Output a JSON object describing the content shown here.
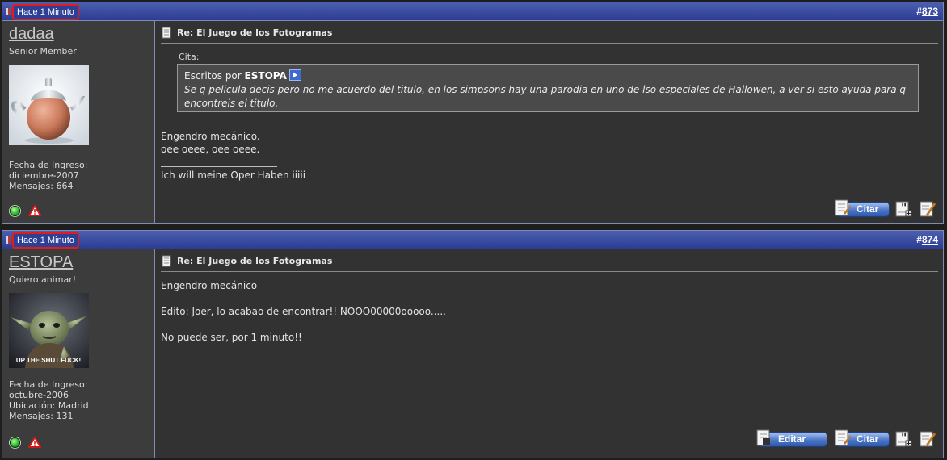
{
  "posts": [
    {
      "time": "Hace 1 Minuto",
      "hash": "#",
      "number": "873",
      "username": "dadaa",
      "usertitle": "Senior Member",
      "join_label": "Fecha de Ingreso:",
      "join_date": "diciembre-2007",
      "messages": "Mensajes: 664",
      "title": "Re: El Juego de los Fotogramas",
      "quote": {
        "label": "Cita:",
        "by_prefix": "Escritos por",
        "by_user": "ESTOPA",
        "text": "Se q pelicula decis pero no me acuerdo del titulo, en los simpsons hay una parodia en uno de lso especiales de Hallowen, a ver si esto ayuda para q encontreis el titulo."
      },
      "body": [
        "Engendro mecánico.",
        "oee oeee, oee oeee."
      ],
      "signature": "Ich will meine Oper Haben iiiii",
      "buttons": {
        "quote": "Citar"
      }
    },
    {
      "time": "Hace 1 Minuto",
      "hash": "#",
      "number": "874",
      "username": "ESTOPA",
      "usertitle": "Quiero animar!",
      "avatar_caption": "UP THE SHUT FUCK!",
      "join_label": "Fecha de Ingreso:",
      "join_date": "octubre-2006",
      "location": "Ubicación: Madrid",
      "messages": "Mensajes: 131",
      "title": "Re: El Juego de los Fotogramas",
      "body": [
        "Engendro mecánico",
        "Edito: Joer, lo acabao de encontrar!! NOOO00000ooooo.....",
        "No puede ser, por 1 minuto!!"
      ],
      "buttons": {
        "edit": "Editar",
        "quote": "Citar"
      }
    }
  ],
  "colors": {
    "header_blue": "#2e3f96",
    "highlight_red": "#e21b1b",
    "panel_bg": "#3c3c3c",
    "content_bg": "#323232"
  },
  "icons": [
    "flag-icon",
    "document-icon",
    "online-status-icon",
    "report-post-icon",
    "view-post-arrow-icon",
    "multi-quote-icon",
    "quick-reply-icon"
  ]
}
